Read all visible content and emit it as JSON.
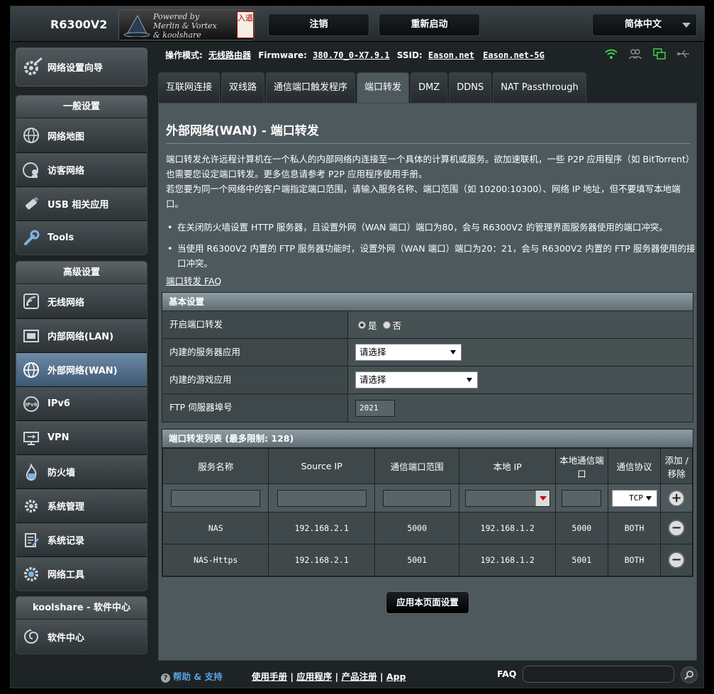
{
  "header": {
    "model": "R6300V2",
    "logo_lines": [
      "Powered by",
      "Merlin & Vortex",
      "& koolshare"
    ],
    "logo_seal": "入道",
    "logout": "注销",
    "reboot": "重新启动",
    "language": "简体中文"
  },
  "sidebar": {
    "wizard": "网络设置向导",
    "general_title": "一般设置",
    "general": [
      {
        "label": "网络地图",
        "icon": "globe-map-icon"
      },
      {
        "label": "访客网络",
        "icon": "guest-network-icon"
      },
      {
        "label": "USB 相关应用",
        "icon": "usb-icon"
      },
      {
        "label": "Tools",
        "icon": "wrench-icon"
      }
    ],
    "advanced_title": "高级设置",
    "advanced": [
      {
        "label": "无线网络",
        "icon": "wireless-icon"
      },
      {
        "label": "内部网络(LAN)",
        "icon": "lan-icon"
      },
      {
        "label": "外部网络(WAN)",
        "icon": "wan-globe-icon"
      },
      {
        "label": "IPv6",
        "icon": "ipv6-icon"
      },
      {
        "label": "VPN",
        "icon": "vpn-icon"
      },
      {
        "label": "防火墙",
        "icon": "firewall-icon"
      },
      {
        "label": "系统管理",
        "icon": "admin-icon"
      },
      {
        "label": "系统记录",
        "icon": "log-icon"
      },
      {
        "label": "网络工具",
        "icon": "network-tools-icon"
      }
    ],
    "koolshare_title": "koolshare - 软件中心",
    "koolshare_item": "软件中心"
  },
  "status": {
    "mode_label": "操作模式:",
    "mode_value": "无线路由器",
    "fw_label": "Firmware:",
    "fw_value": "380.70_0-X7.9.1",
    "ssid_label": "SSID:",
    "ssid1": "Eason.net",
    "ssid2": "Eason.net-5G"
  },
  "tabs": [
    "互联网连接",
    "双线路",
    "通信端口触发程序",
    "端口转发",
    "DMZ",
    "DDNS",
    "NAT Passthrough"
  ],
  "active_tab": 3,
  "page": {
    "title": "外部网络(WAN) - 端口转发",
    "desc1": "端口转发允许远程计算机在一个私人的内部网络内连接至一个具体的计算机或服务。欲加速联机，一些 P2P 应用程序（如 BitTorrent）也需要您设定端口转发。更多信息请参考 P2P 应用程序使用手册。",
    "desc2": "若您要为同一个网络中的客户端指定端口范围，请输入服务名称、端口范围（如 10200:10300）、网络 IP 地址，但不要填写本地端口。",
    "bullet1": "在关闭防火墙设置 HTTP 服务器，且设置外网（WAN 端口）端口为80，会与 R6300V2 的管理界面服务器使用的端口冲突。",
    "bullet2": "当使用 R6300V2 内置的 FTP 服务器功能时，设置外网（WAN 端口）端口为20：21，会与 R6300V2 内置的 FTP 服务器使用的接口冲突。",
    "faq_link": "端口转发 FAQ"
  },
  "basic": {
    "title": "基本设置",
    "enable_label": "开启端口转发",
    "yes": "是",
    "no": "否",
    "server_label": "内建的服务器应用",
    "server_select": "请选择",
    "game_label": "内建的游戏应用",
    "game_select": "请选择",
    "ftp_label": "FTP 伺服器埠号",
    "ftp_value": "2021"
  },
  "pf_list": {
    "title": "端口转发列表 (最多限制:  128)",
    "columns": [
      "服务名称",
      "Source IP",
      "通信端口范围",
      "本地 IP",
      "本地通信端口",
      "通信协议",
      "添加 / 移除"
    ],
    "new_protocol": "TCP",
    "rows": [
      {
        "name": "NAS",
        "source_ip": "192.168.2.1",
        "port_range": "5000",
        "local_ip": "192.168.1.2",
        "local_port": "5000",
        "protocol": "BOTH"
      },
      {
        "name": "NAS-Https",
        "source_ip": "192.168.2.1",
        "port_range": "5001",
        "local_ip": "192.168.1.2",
        "local_port": "5001",
        "protocol": "BOTH"
      }
    ]
  },
  "apply_button": "应用本页面设置",
  "footer": {
    "help": "帮助 & 支持",
    "manual": "使用手册",
    "apps": "应用程序",
    "register": "产品注册",
    "app": "App",
    "faq": "FAQ"
  }
}
